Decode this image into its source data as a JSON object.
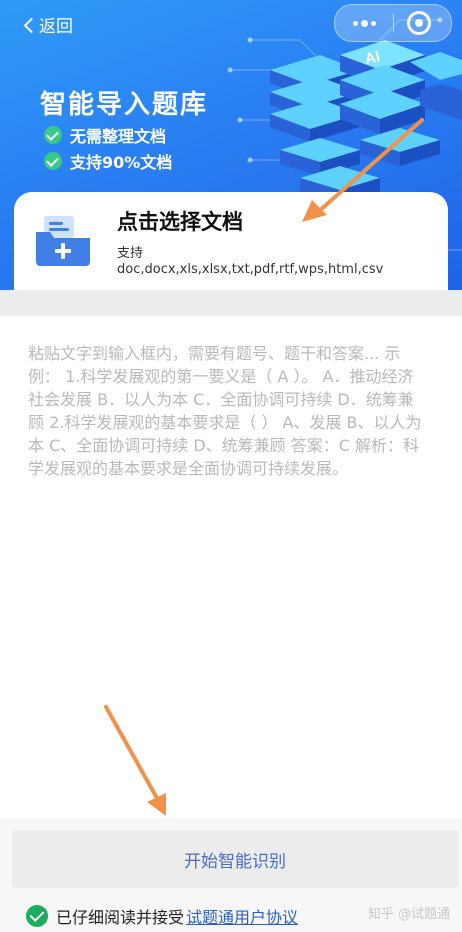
{
  "nav": {
    "back_label": "返回"
  },
  "hero": {
    "title": "智能导入题库",
    "features": [
      "无需整理文档",
      "支持90%文档"
    ],
    "ai_badge": "AI",
    "accent_color": "#2a7ff2"
  },
  "upload": {
    "title": "点击选择文档",
    "supported_label": "支持",
    "formats": "doc,docx,xls,xlsx,txt,pdf,rtf,wps,html,csv",
    "icon": "folder-plus-icon"
  },
  "paste": {
    "placeholder": "粘贴文字到输入框内，需要有题号、题干和答案... 示例： 1.科学发展观的第一要义是（ A ）。 A．推动经济社会发展 B．以人为本 C．全面协调可持续 D．统筹兼顾 2.科学发展观的基本要求是（ ） A、发展 B、以人为本 C、全面协调可持续 D、统筹兼顾 答案：C 解析：科学发展观的基本要求是全面协调可持续发展。"
  },
  "actions": {
    "start_label": "开始智能识别"
  },
  "agreement": {
    "prefix": "已仔细阅读并接受",
    "link_text": "试题通用户协议"
  },
  "watermark": "知乎 @试题通",
  "colors": {
    "arrow": "#f0924a",
    "check_green": "#1aad5f",
    "link_blue": "#2b5fc7"
  }
}
